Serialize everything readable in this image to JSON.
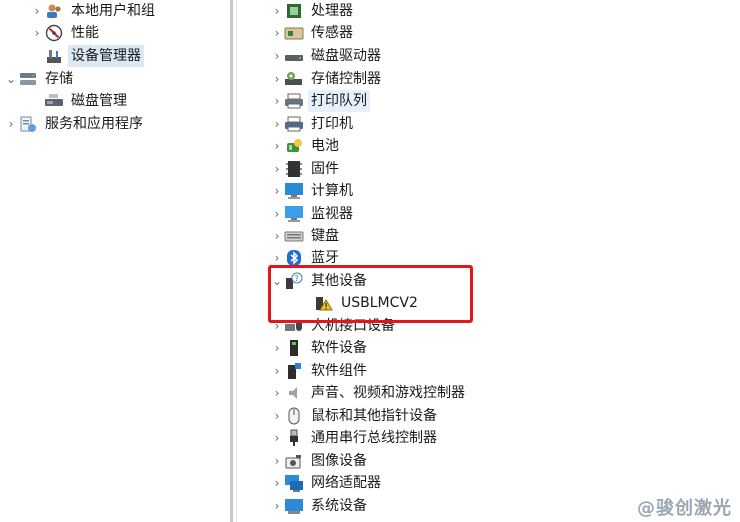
{
  "left_tree": [
    {
      "label": "本地用户和组",
      "icon": "users-icon"
    },
    {
      "label": "性能",
      "icon": "performance-icon"
    },
    {
      "label": "设备管理器",
      "icon": "device-manager-icon"
    },
    {
      "label": "存储",
      "icon": "storage-icon"
    },
    {
      "label": "磁盘管理",
      "icon": "disk-management-icon"
    },
    {
      "label": "服务和应用程序",
      "icon": "services-icon"
    }
  ],
  "right_tree": [
    {
      "label": "处理器",
      "icon": "processor-icon"
    },
    {
      "label": "传感器",
      "icon": "sensor-icon"
    },
    {
      "label": "磁盘驱动器",
      "icon": "disk-drive-icon"
    },
    {
      "label": "存储控制器",
      "icon": "storage-controller-icon"
    },
    {
      "label": "打印队列",
      "icon": "print-queue-icon"
    },
    {
      "label": "打印机",
      "icon": "printer-icon"
    },
    {
      "label": "电池",
      "icon": "battery-icon"
    },
    {
      "label": "固件",
      "icon": "firmware-icon"
    },
    {
      "label": "计算机",
      "icon": "computer-icon"
    },
    {
      "label": "监视器",
      "icon": "monitor-icon"
    },
    {
      "label": "键盘",
      "icon": "keyboard-icon"
    },
    {
      "label": "蓝牙",
      "icon": "bluetooth-icon"
    },
    {
      "label": "其他设备",
      "icon": "other-devices-icon"
    },
    {
      "label": "USBLMCV2",
      "icon": "warning-device-icon"
    },
    {
      "label": "人机接口设备",
      "icon": "hid-icon"
    },
    {
      "label": "软件设备",
      "icon": "software-device-icon"
    },
    {
      "label": "软件组件",
      "icon": "software-component-icon"
    },
    {
      "label": "声音、视频和游戏控制器",
      "icon": "sound-icon"
    },
    {
      "label": "鼠标和其他指针设备",
      "icon": "mouse-icon"
    },
    {
      "label": "通用串行总线控制器",
      "icon": "usb-icon"
    },
    {
      "label": "图像设备",
      "icon": "camera-icon"
    },
    {
      "label": "网络适配器",
      "icon": "network-adapter-icon"
    },
    {
      "label": "系统设备",
      "icon": "system-device-icon"
    }
  ],
  "watermark": "@骏创激光",
  "colors": {
    "highlight_box": "#e2161b",
    "selection": "#dbe9f7"
  }
}
